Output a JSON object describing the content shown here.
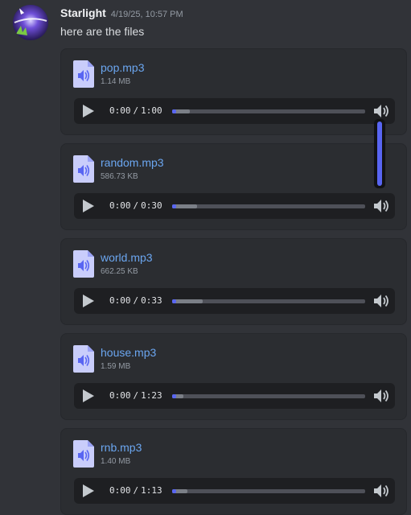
{
  "message": {
    "username": "Starlight",
    "timestamp": "4/19/25, 10:57 PM",
    "content": "here are the files"
  },
  "attachments": [
    {
      "file_name": "pop.mp3",
      "file_size": "1.14 MB",
      "current_time": "0:00",
      "separator": "/",
      "duration": "1:00",
      "buffered_fraction": 0.09,
      "played_fraction": 0.0
    },
    {
      "file_name": "random.mp3",
      "file_size": "586.73 KB",
      "current_time": "0:00",
      "separator": "/",
      "duration": "0:30",
      "buffered_fraction": 0.13,
      "played_fraction": 0.0
    },
    {
      "file_name": "world.mp3",
      "file_size": "662.25 KB",
      "current_time": "0:00",
      "separator": "/",
      "duration": "0:33",
      "buffered_fraction": 0.16,
      "played_fraction": 0.0
    },
    {
      "file_name": "house.mp3",
      "file_size": "1.59 MB",
      "current_time": "0:00",
      "separator": "/",
      "duration": "1:23",
      "buffered_fraction": 0.06,
      "played_fraction": 0.0
    },
    {
      "file_name": "rnb.mp3",
      "file_size": "1.40 MB",
      "current_time": "0:00",
      "separator": "/",
      "duration": "1:13",
      "buffered_fraction": 0.08,
      "played_fraction": 0.0
    }
  ],
  "volume_level": 1.0,
  "icons": {
    "avatar": "avatar",
    "file": "audio-file-icon",
    "play": "play-icon",
    "volume": "volume-icon"
  },
  "colors": {
    "background": "#313338",
    "attachment_bg": "#2b2d31",
    "player_bg": "#1e1f22",
    "link": "#6ba6f0",
    "accent": "#5865f2",
    "file_icon": "#c9cdfb"
  }
}
